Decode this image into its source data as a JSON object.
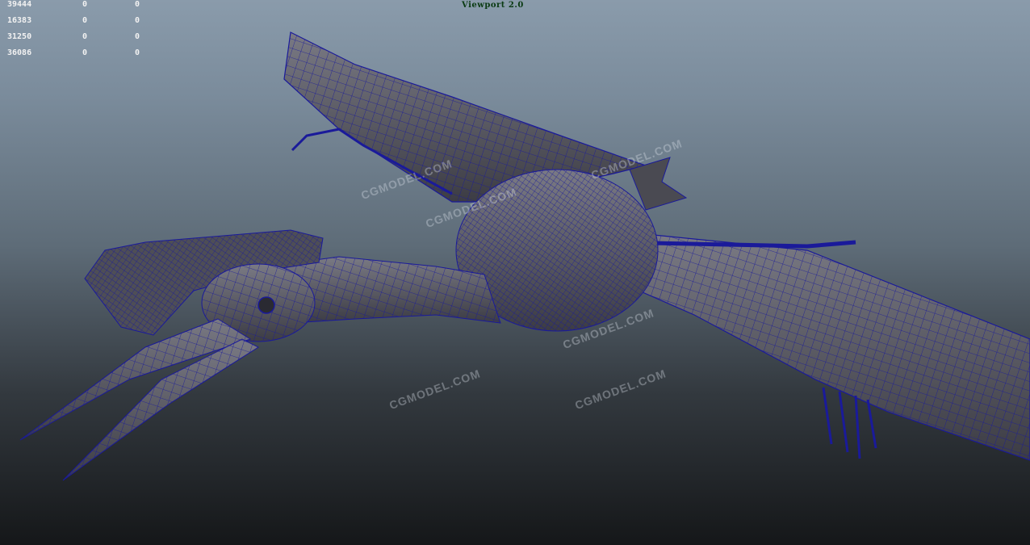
{
  "viewport": {
    "title": "Viewport 2.0"
  },
  "hud_stats": [
    [
      "39444",
      "0",
      "0"
    ],
    [
      "16383",
      "0",
      "0"
    ],
    [
      "31250",
      "0",
      "0"
    ],
    [
      "36086",
      "0",
      "0"
    ]
  ],
  "watermarks": [
    "CGMODEL.COM",
    "CGMODEL.COM",
    "CGMODEL.COM",
    "CGMODEL.COM",
    "CGMODEL.COM",
    "CGMODEL.COM"
  ],
  "colors": {
    "wire": "#1a1a9a",
    "mesh": "#6a6a72",
    "mesh_dark": "#3c3c44"
  },
  "model": {
    "icon": "pterosaur-wireframe-icon"
  }
}
